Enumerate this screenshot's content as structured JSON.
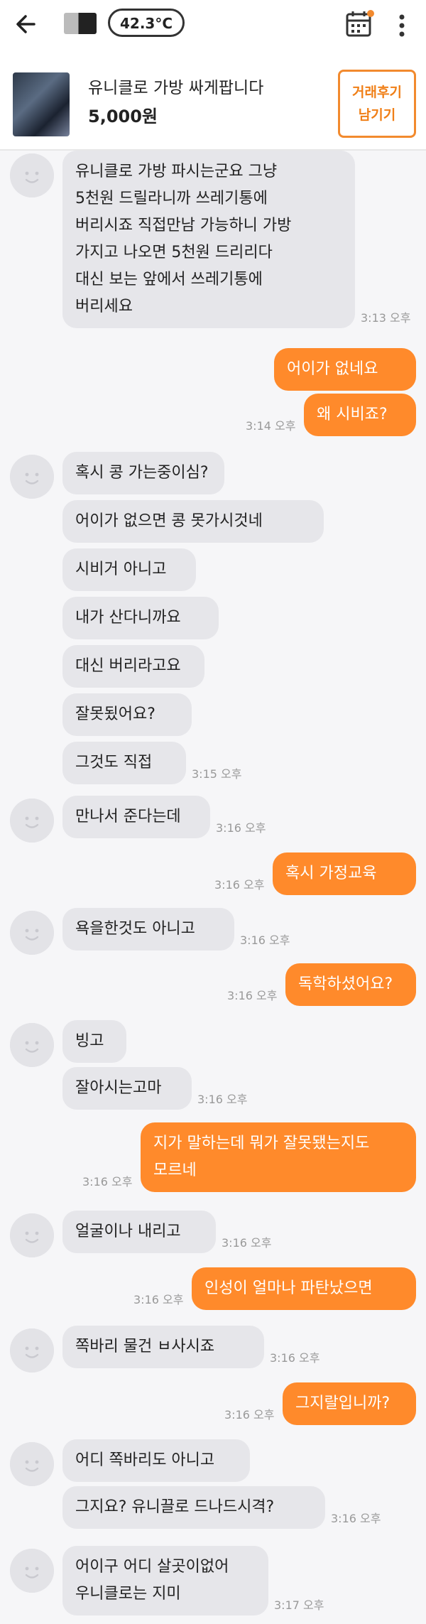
{
  "header": {
    "temperature": "42.3°C",
    "back_icon": "back-arrow-icon",
    "calendar_icon": "calendar-icon",
    "accent_color": "#f28a2e"
  },
  "item": {
    "title": "유니클로 가방 싸게팝니다",
    "price": "5,000원",
    "review_line1": "거래후기",
    "review_line2": "남기기"
  },
  "messages": [
    {
      "side": "in",
      "lines": [
        "유니클로 가방 파시는군요 그냥",
        "5천원 드릴라니까 쓰레기통에",
        "버리시죠 직접만남 가능하니 가방",
        "가지고 나오면 5천원 드리리다",
        "대신 보는 앞에서 쓰레기통에",
        "버리세요"
      ],
      "time": "3:13 오후"
    },
    {
      "side": "out",
      "lines": [
        "어이가 없네요"
      ]
    },
    {
      "side": "out",
      "lines": [
        "왜 시비죠?"
      ],
      "time": "3:14 오후"
    },
    {
      "side": "in",
      "lines": [
        "혹시 콩 가는중이심?"
      ]
    },
    {
      "side": "in",
      "lines": [
        "어이가 없으면 콩 못가시것네"
      ]
    },
    {
      "side": "in",
      "lines": [
        "시비거 아니고"
      ]
    },
    {
      "side": "in",
      "lines": [
        "내가 산다니까요"
      ]
    },
    {
      "side": "in",
      "lines": [
        "대신 버리라고요"
      ]
    },
    {
      "side": "in",
      "lines": [
        "잘못됬어요?"
      ]
    },
    {
      "side": "in",
      "lines": [
        "그것도 직접"
      ],
      "time": "3:15 오후"
    },
    {
      "side": "in",
      "lines": [
        "만나서 준다는데"
      ],
      "time": "3:16 오후"
    },
    {
      "side": "out",
      "lines": [
        "혹시 가정교육"
      ],
      "time": "3:16 오후"
    },
    {
      "side": "in",
      "lines": [
        "욕을한것도 아니고"
      ],
      "time": "3:16 오후"
    },
    {
      "side": "out",
      "lines": [
        "독학하셨어요?"
      ],
      "time": "3:16 오후"
    },
    {
      "side": "in",
      "lines": [
        "빙고"
      ]
    },
    {
      "side": "in",
      "lines": [
        "잘아시는고마"
      ],
      "time": "3:16 오후"
    },
    {
      "side": "out",
      "lines": [
        "지가 말하는데 뭐가 잘못됐는지도",
        "모르네"
      ],
      "time": "3:16 오후"
    },
    {
      "side": "in",
      "lines": [
        "얼굴이나 내리고"
      ],
      "time": "3:16 오후"
    },
    {
      "side": "out",
      "lines": [
        "인성이 얼마나 파탄났으면"
      ],
      "time": "3:16 오후"
    },
    {
      "side": "in",
      "lines": [
        "쪽바리 물건 ㅂ사시죠"
      ],
      "time": "3:16 오후"
    },
    {
      "side": "out",
      "lines": [
        "그지랄입니까?"
      ],
      "time": "3:16 오후"
    },
    {
      "side": "in",
      "lines": [
        "어디 쪽바리도 아니고"
      ]
    },
    {
      "side": "in",
      "lines": [
        "그지요? 유니끌로 드나드시격?"
      ],
      "time": "3:16 오후"
    },
    {
      "side": "in",
      "lines": [
        "어이구 어디 살곳이없어",
        "우니클로는 지미"
      ],
      "time": "3:17 오후"
    }
  ]
}
